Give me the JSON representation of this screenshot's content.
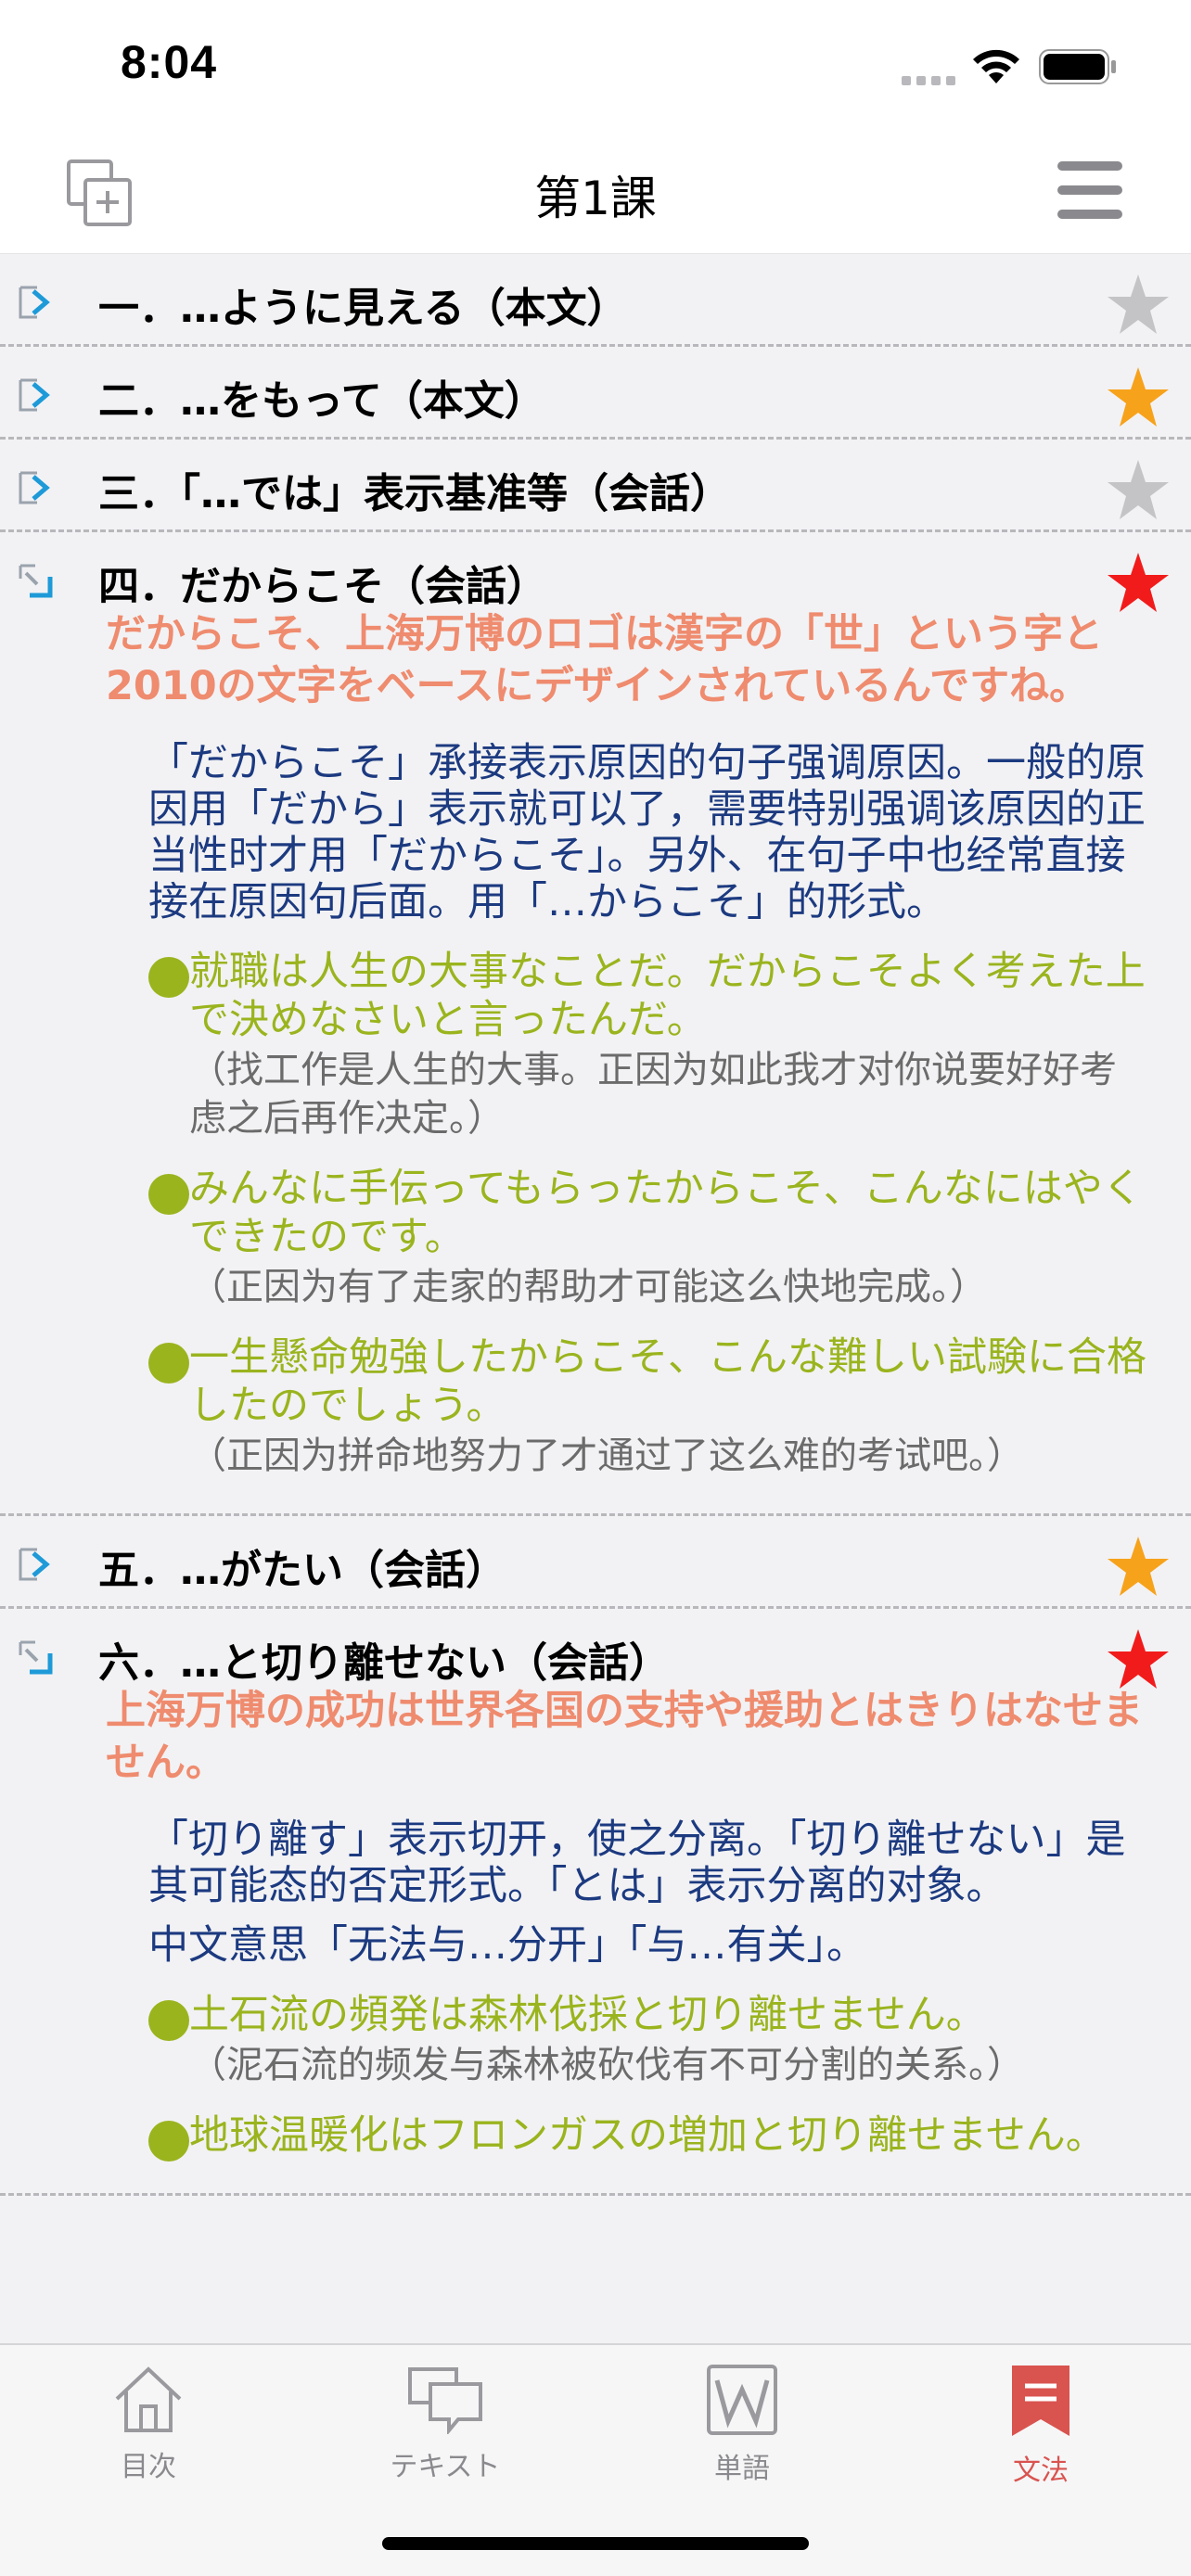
{
  "status": {
    "time": "8:04"
  },
  "nav": {
    "title": "第1課",
    "add_icon": "add-to-collection-icon",
    "menu_icon": "hamburger-menu-icon"
  },
  "colors": {
    "star_gray": "#c4c4c6",
    "star_orange": "#f7a21b",
    "star_red": "#f21b1b",
    "example_jp": "#ef8b6e",
    "explain": "#1c3a80",
    "sentence_green": "#9ab41e",
    "tab_active": "#d9534f"
  },
  "sections": [
    {
      "title": "一．…ように見える（本文）",
      "star": "gray",
      "expanded": false
    },
    {
      "title": "二．…をもって（本文）",
      "star": "orange",
      "expanded": false
    },
    {
      "title": "三．「…では」表示基准等（会話）",
      "star": "gray",
      "expanded": false
    },
    {
      "title": "四．だからこそ（会話）",
      "star": "red",
      "expanded": true,
      "example": "だからこそ、上海万博のロゴは漢字の「世」という字と2010の文字をベースにデザインされているんですね。",
      "explanations": [
        "「だからこそ」承接表示原因的句子强调原因。一般的原因用「だから」表示就可以了，需要特别强调该原因的正当性时才用「だからこそ」。另外、在句子中也经常直接接在原因句后面。用「…からこそ」的形式。"
      ],
      "sentences": [
        {
          "jp": "就職は人生の大事なことだ。だからこそよく考えた上で決めなさいと言ったんだ。",
          "cn": "（找工作是人生的大事。正因为如此我才对你说要好好考虑之后再作决定。）"
        },
        {
          "jp": "みんなに手伝ってもらったからこそ、こんなにはやくできたのです。",
          "cn": "（正因为有了走家的帮助才可能这么快地完成。）"
        },
        {
          "jp": "一生懸命勉強したからこそ、こんな難しい試験に合格したのでしょう。",
          "cn": "（正因为拼命地努力了才通过了这么难的考试吧。）"
        }
      ]
    },
    {
      "title": "五．…がたい（会話）",
      "star": "orange",
      "expanded": false
    },
    {
      "title": "六．…と切り離せない（会話）",
      "star": "red",
      "expanded": true,
      "example": "上海万博の成功は世界各国の支持や援助とはきりはなせません。",
      "explanations": [
        "「切り離す」表示切开，使之分离。「切り離せない」是其可能态的否定形式。「とは」表示分离的对象。",
        "中文意思「无法与…分开」「与…有关」。"
      ],
      "sentences": [
        {
          "jp": "土石流の頻発は森林伐採と切り離せません。",
          "cn": "（泥石流的频发与森林被砍伐有不可分割的关系。）"
        },
        {
          "jp": "地球温暖化はフロンガスの増加と切り離せません。",
          "cn": ""
        }
      ]
    }
  ],
  "tabs": [
    {
      "label": "目次",
      "icon": "home-icon",
      "active": false
    },
    {
      "label": "テキスト",
      "icon": "speech-bubbles-icon",
      "active": false
    },
    {
      "label": "単語",
      "icon": "word-w-icon",
      "active": false
    },
    {
      "label": "文法",
      "icon": "bookmark-list-icon",
      "active": true
    }
  ]
}
